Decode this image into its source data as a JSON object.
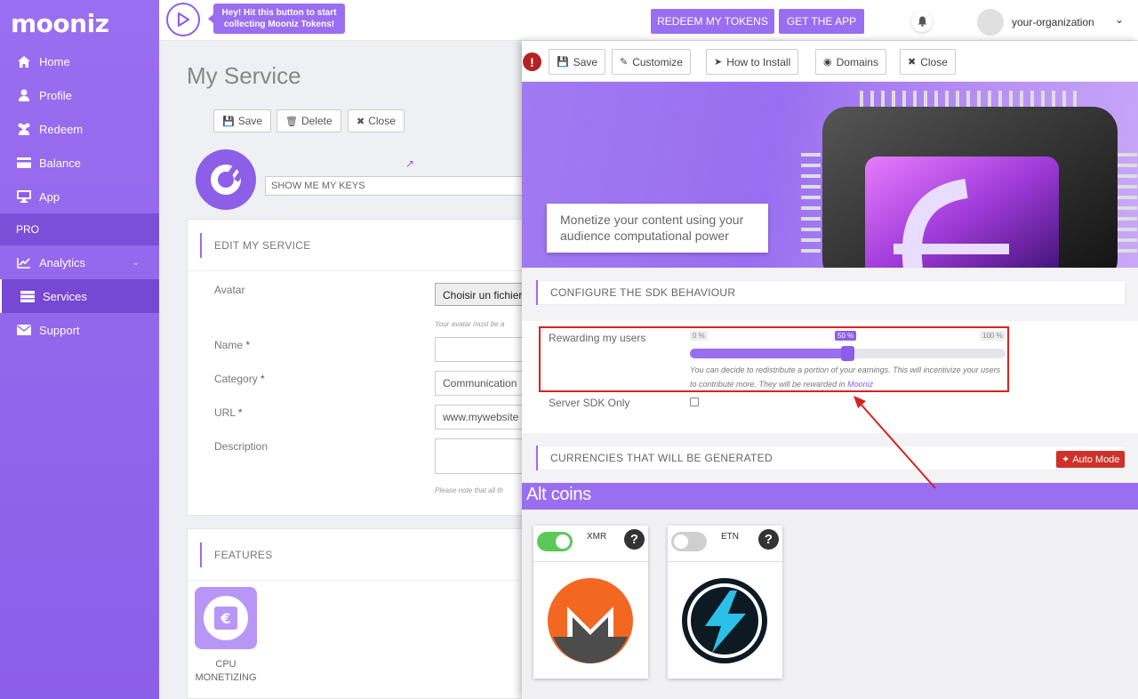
{
  "brand": {
    "logo_text": "mooniz",
    "accent": "#9a6ef0",
    "accent_dark": "#8d5ee8",
    "danger": "#d9221d"
  },
  "sidebar": {
    "items": [
      {
        "label": "Home",
        "icon": "home-icon"
      },
      {
        "label": "Profile",
        "icon": "user-icon"
      },
      {
        "label": "Redeem",
        "icon": "users-icon"
      },
      {
        "label": "Balance",
        "icon": "credit-card-icon"
      },
      {
        "label": "App",
        "icon": "desktop-icon"
      }
    ],
    "section": "PRO",
    "pro_items": [
      {
        "label": "Analytics",
        "icon": "chart-icon"
      },
      {
        "label": "Services",
        "icon": "server-icon"
      },
      {
        "label": "Support",
        "icon": "envelope-icon"
      }
    ]
  },
  "topbar": {
    "tip": "Hey! Hit this button to start collecting Mooniz Tokens!",
    "redeem": "REDEEM MY TOKENS",
    "get_app": "GET THE APP",
    "org": "your-organization"
  },
  "service": {
    "title": "My Service",
    "save": "Save",
    "delete": "Delete",
    "close": "Close",
    "keys_placeholder": "SHOW ME MY KEYS",
    "edit_heading": "EDIT MY SERVICE",
    "avatar_label": "Avatar",
    "file_button": "Choisir un fichier",
    "avatar_note": "Your avatar must be a",
    "name_label": "Name",
    "category_label": "Category",
    "category_value": "Communication",
    "url_label": "URL",
    "url_value": "www.mywebsite",
    "description_label": "Description",
    "note": "Please note that all th",
    "required": "*",
    "features_heading": "FEATURES",
    "feature_label": "CPU MONETIZING"
  },
  "overlay": {
    "save": "Save",
    "customize": "Customize",
    "install": "How to Install",
    "domains": "Domains",
    "close": "Close",
    "banner_text": "Monetize your content using your audience computational power",
    "sdk_heading": "CONFIGURE THE SDK BEHAVIOUR",
    "reward_label": "Rewarding my users",
    "slider_min": "0 %",
    "slider_value": "50 %",
    "slider_max": "100 %",
    "slider_fraction": 0.5,
    "reward_note": "You can decide to redistribute a portion of your earnings. This will incentivize your users to contribute more. They will be rewarded in",
    "reward_link": "Mooniz",
    "server_sdk": "Server SDK Only",
    "currencies_heading": "CURRENCIES THAT WILL BE GENERATED",
    "auto_mode": "Auto Mode",
    "alt_coins": "Alt coins",
    "coins": [
      {
        "name": "XMR",
        "enabled": true
      },
      {
        "name": "ETN",
        "enabled": false
      }
    ]
  }
}
